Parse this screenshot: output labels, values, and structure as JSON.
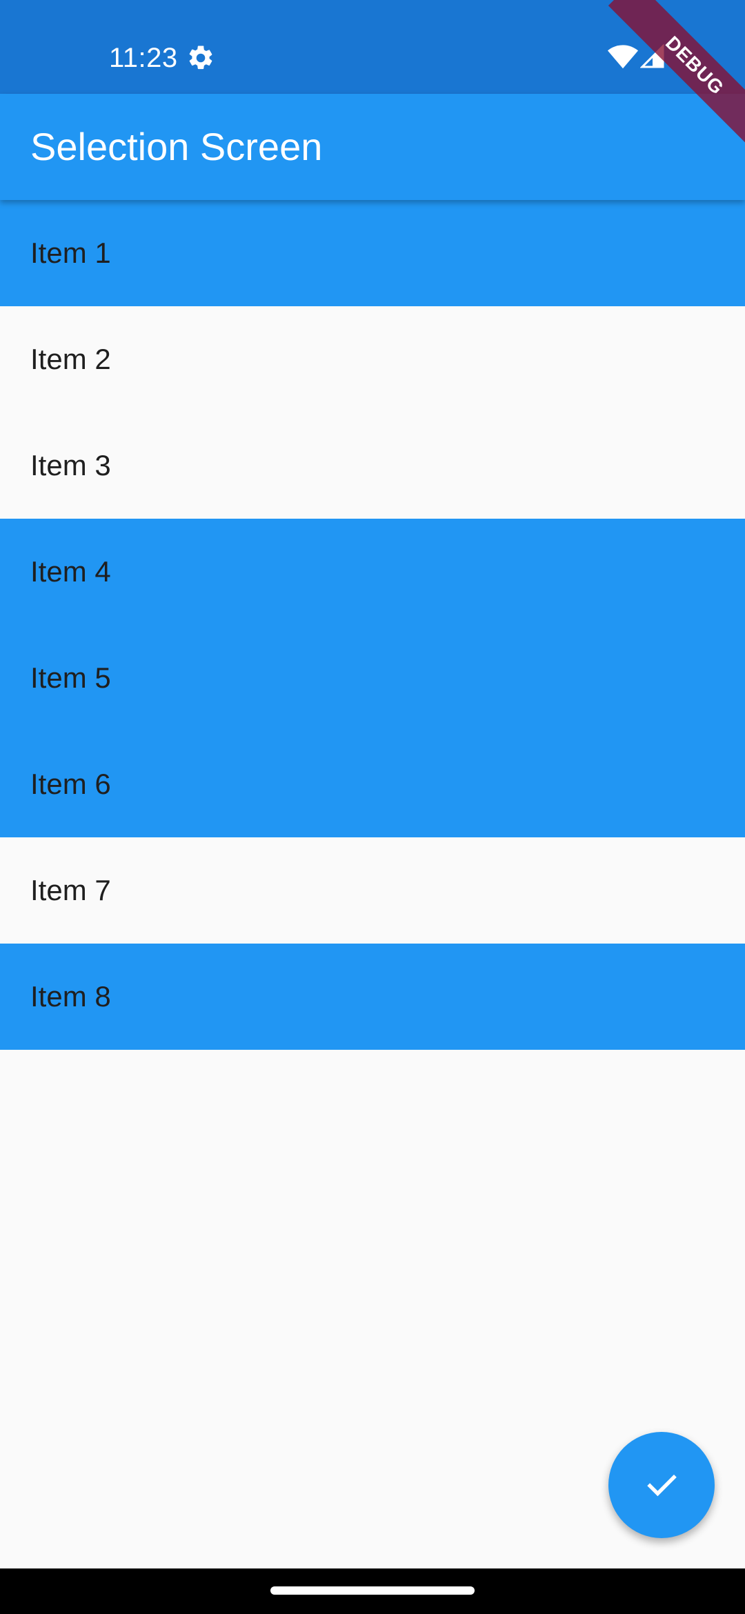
{
  "status_bar": {
    "time": "11:23",
    "icons": [
      "gear-icon",
      "wifi-icon",
      "cell-signal-icon"
    ],
    "background": "#1976D2"
  },
  "debug_banner": {
    "label": "DEBUG"
  },
  "app_bar": {
    "title": "Selection Screen",
    "background": "#2196F3"
  },
  "list": {
    "selected_color": "#2196F3",
    "items": [
      {
        "label": "Item 1",
        "selected": true
      },
      {
        "label": "Item 2",
        "selected": false
      },
      {
        "label": "Item 3",
        "selected": false
      },
      {
        "label": "Item 4",
        "selected": true
      },
      {
        "label": "Item 5",
        "selected": true
      },
      {
        "label": "Item 6",
        "selected": true
      },
      {
        "label": "Item 7",
        "selected": false
      },
      {
        "label": "Item 8",
        "selected": true
      }
    ]
  },
  "fab": {
    "icon": "check-icon",
    "background": "#2196F3"
  }
}
